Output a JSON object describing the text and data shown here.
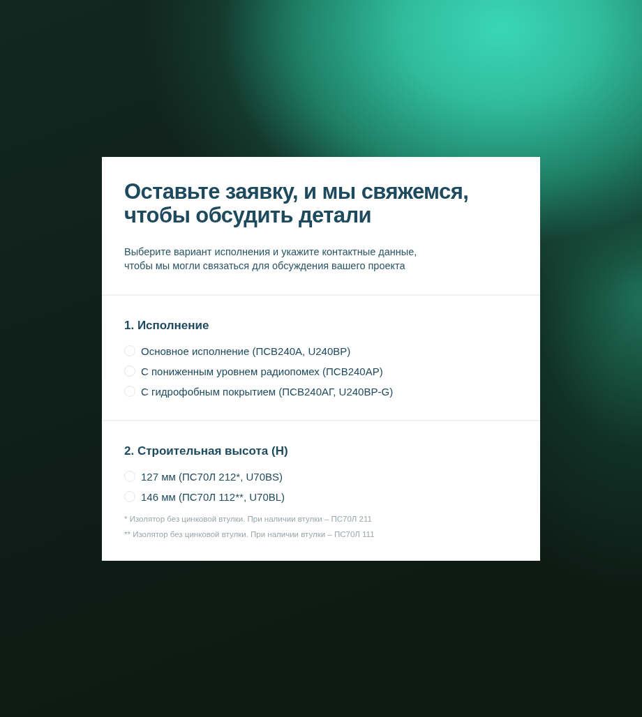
{
  "form": {
    "title": "Оставьте заявку, и мы свяжемся, чтобы обсудить детали",
    "subtitle": "Выберите вариант исполнения и укажите контактные данные, чтобы мы могли связаться для обсуждения вашего проекта"
  },
  "sections": [
    {
      "heading": "1. Исполнение",
      "options": [
        {
          "label": "Основное исполнение (ПСВ240А, U240BP)",
          "selected": false
        },
        {
          "label": "С пониженным уровнем радиопомех (ПСВ240АР)",
          "selected": false
        },
        {
          "label": "С гидрофобным покрытием (ПСВ240АГ, U240BP-G)",
          "selected": false
        }
      ]
    },
    {
      "heading": "2. Строительная высота (H)",
      "options": [
        {
          "label": "127 мм (ПС70Л 212*, U70BS)",
          "selected": false
        },
        {
          "label": "146 мм (ПС70Л 112**, U70BL)",
          "selected": false
        }
      ],
      "footnotes": [
        "* Изолятор без цинковой втулки. При наличии втулки – ПС70Л 211",
        "** Изолятор без цинковой втулки. При наличии втулки – ПС70Л 111"
      ]
    }
  ]
}
